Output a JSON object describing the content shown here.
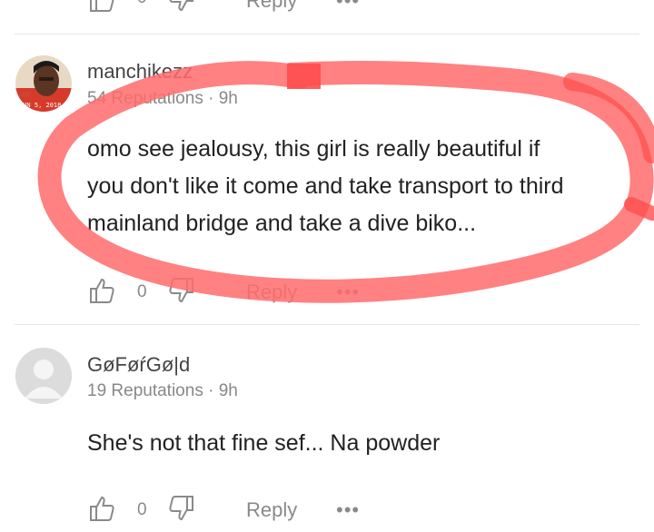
{
  "top_partial": {
    "count": "0",
    "reply_label": "Reply",
    "more_label": "•••"
  },
  "comments": [
    {
      "username": "manchikezz",
      "reputation": "54 Reputations",
      "time": "· 9h",
      "avatar_stamp": "JUN 5, 2018",
      "lines": [
        "omo see jealousy, this girl is really beautiful if",
        "you don't like it come and take transport to third",
        "mainland bridge and take a dive biko..."
      ],
      "likes": "0",
      "reply_label": "Reply",
      "more_label": "•••"
    },
    {
      "username": "GøFøŕGø|d",
      "reputation": "19 Reputations",
      "time": "· 9h",
      "lines": [
        "She's not that fine sef... Na powder"
      ],
      "likes": "0",
      "reply_label": "Reply",
      "more_label": "•••"
    }
  ],
  "colors": {
    "annotation_stroke": "#ff6b6b",
    "text": "#222222",
    "muted": "#888888",
    "divider": "#e6e6e6"
  },
  "icons": [
    "thumbs-up-icon",
    "thumbs-down-icon",
    "more-icon",
    "default-avatar-icon"
  ]
}
